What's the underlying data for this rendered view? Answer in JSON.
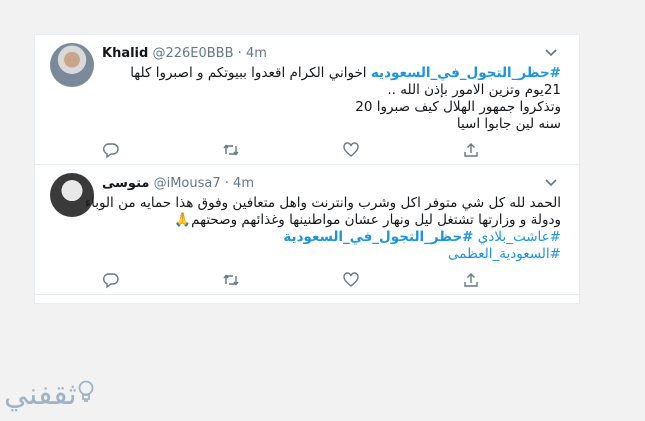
{
  "tweets": [
    {
      "name": "Khalid",
      "handle": "@226E0BBB",
      "dot": "·",
      "time": "4m",
      "lines": [
        {
          "hashtag": "#حظر_التجول_في_السعوديه",
          "text": " اخواني الكرام اقعدوا ببيوتكم و اصبروا كلها"
        },
        {
          "text": "21يوم وتزين الامور بإذن الله .."
        },
        {
          "text": "وتذكروا جمهور الهلال كيف صبروا  20"
        },
        {
          "text": "سنه لين جابوا اسيا"
        }
      ]
    },
    {
      "name": "متوسى",
      "handle": "@iMousa7",
      "dot": "·",
      "time": "4m",
      "lines": [
        {
          "text": "الحمد لله كل شي متوفر اكل وشرب وانترنت واهل متعافين وفوق هذا حمايه من الوباء"
        },
        {
          "text": "ودولة و وزارتها تشتغل ليل ونهار عشان مواطنينها وغذائهم وصحتهم🙏"
        },
        {
          "hashtag1": "#عاشت_بلادي",
          "hashtag2": "#حظر_التجول_في_السعودية"
        },
        {
          "hashtag": "#السعودية_العظمى"
        }
      ]
    }
  ],
  "icons": {
    "reply": "reply-icon",
    "retweet": "retweet-icon",
    "like": "heart-icon",
    "share": "share-icon",
    "more": "chevron-down-icon"
  },
  "watermark": {
    "text": "ثقفني"
  },
  "colors": {
    "link": "#1b95e0",
    "muted": "#657786",
    "border": "#e6ecf0"
  }
}
